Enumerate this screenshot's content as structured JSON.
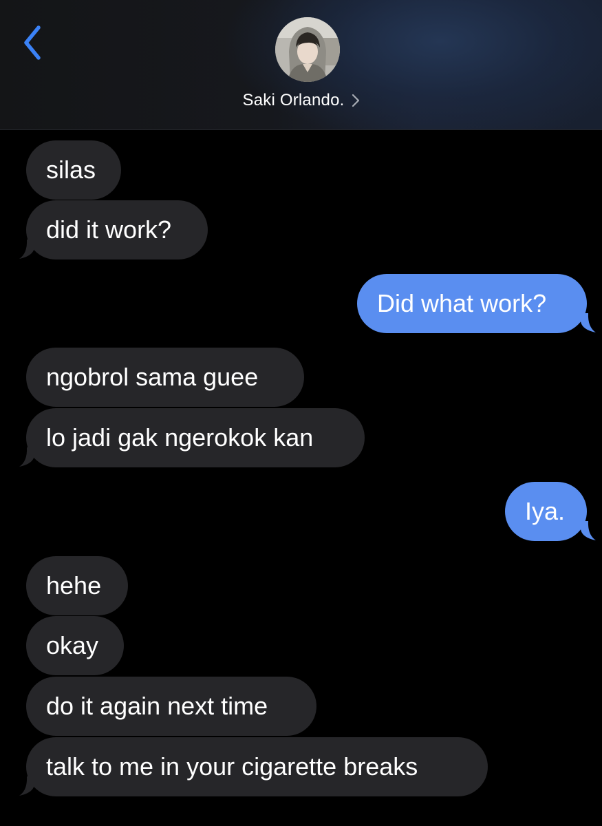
{
  "header": {
    "back_icon": "chevron-left-icon",
    "contact_name": "Saki Orlando.",
    "contact_chevron_icon": "chevron-right-icon",
    "accent_color": "#3b82f6"
  },
  "colors": {
    "incoming_bubble": "#262629",
    "outgoing_bubble": "#5a8ef0",
    "background": "#000000"
  },
  "messages": [
    {
      "direction": "incoming",
      "text": "silas"
    },
    {
      "direction": "incoming",
      "text": "did it work?"
    },
    {
      "direction": "outgoing",
      "text": "Did what work?"
    },
    {
      "direction": "incoming",
      "text": "ngobrol sama guee"
    },
    {
      "direction": "incoming",
      "text": "lo jadi gak ngerokok kan"
    },
    {
      "direction": "outgoing",
      "text": "Iya."
    },
    {
      "direction": "incoming",
      "text": "hehe"
    },
    {
      "direction": "incoming",
      "text": "okay"
    },
    {
      "direction": "incoming",
      "text": "do it again next time"
    },
    {
      "direction": "incoming",
      "text": "talk to me in your cigarette breaks"
    }
  ]
}
